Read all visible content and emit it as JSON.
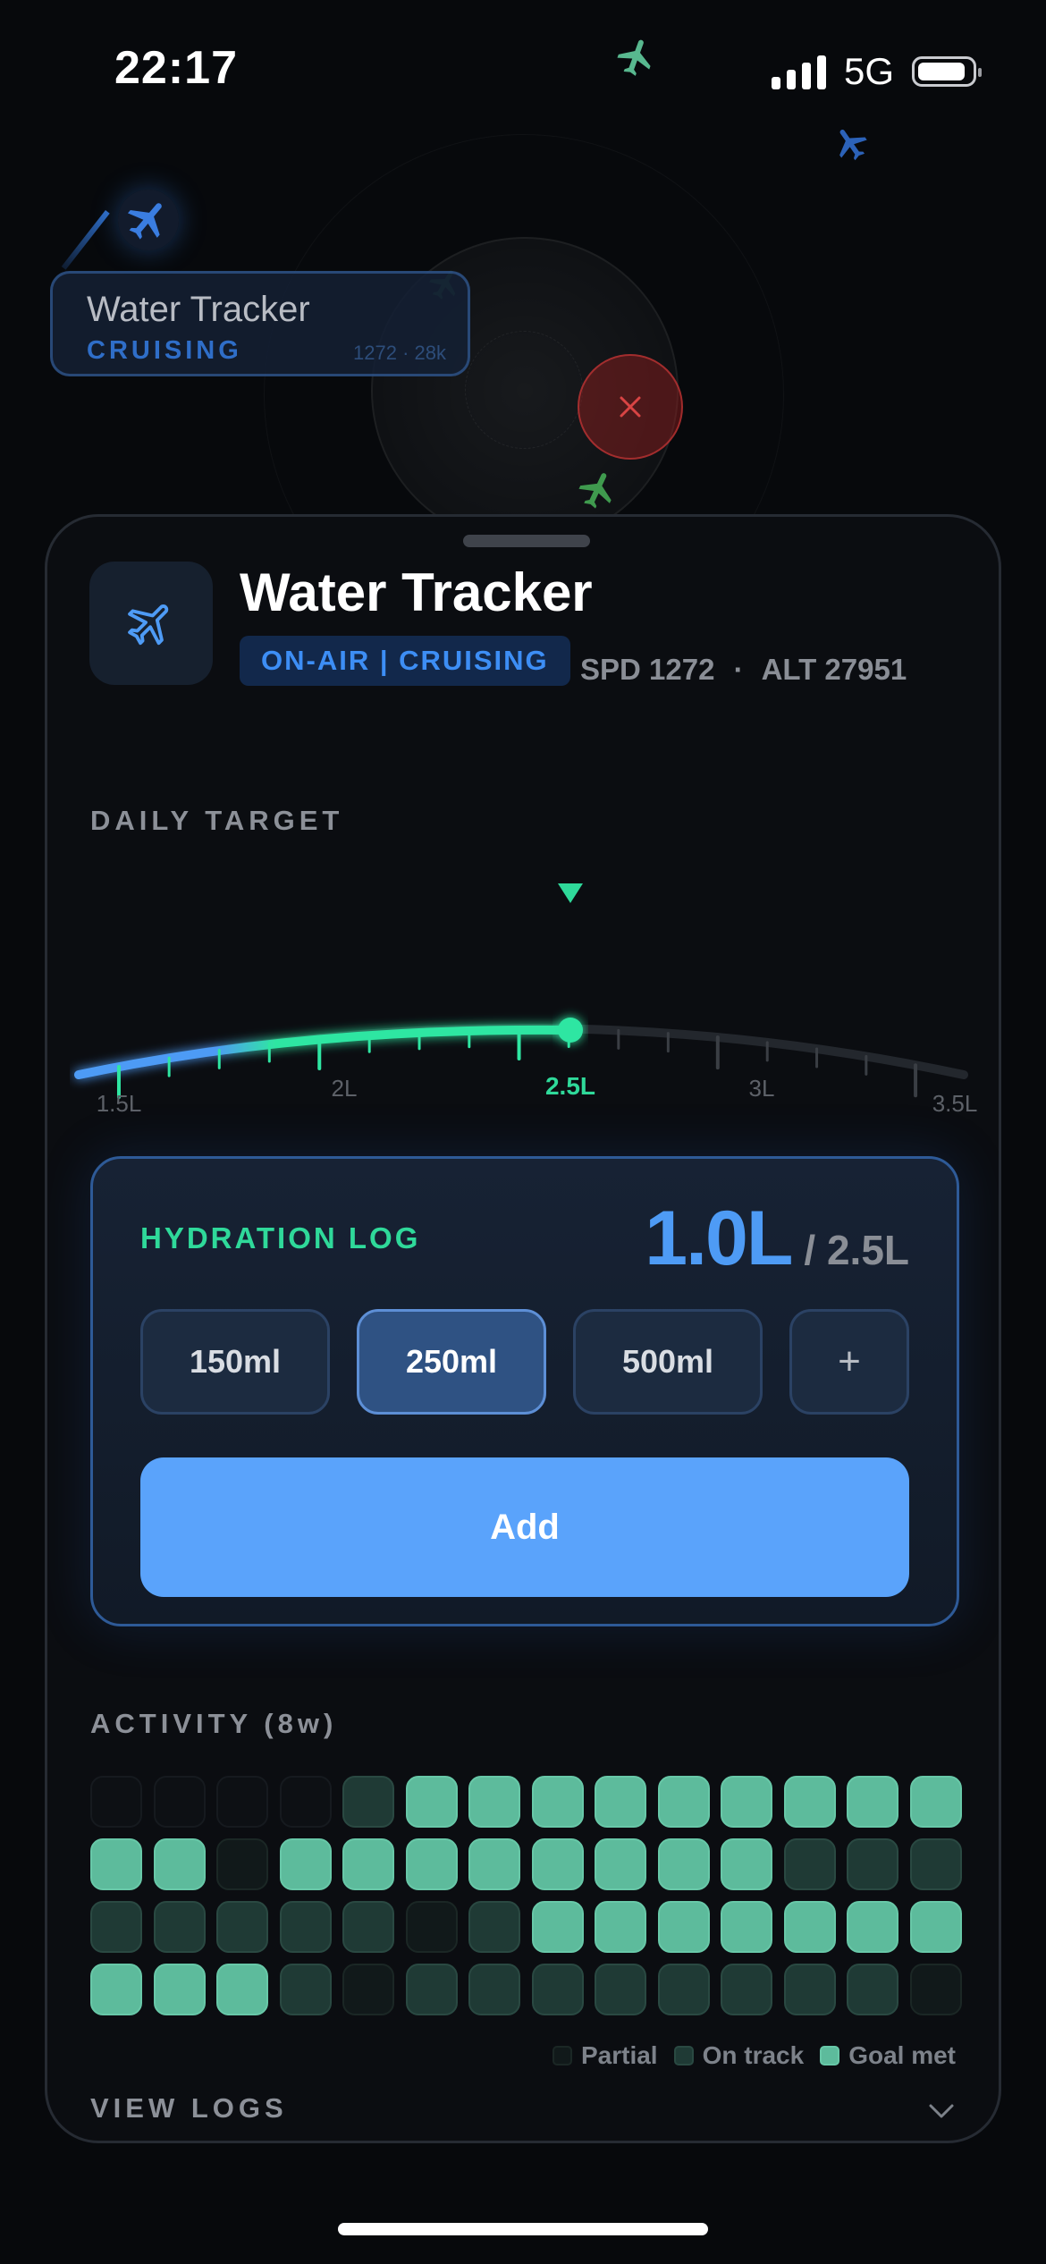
{
  "status_bar": {
    "time": "22:17",
    "network": "5G"
  },
  "map": {
    "flight_tag": {
      "name": "Water Tracker",
      "status": "CRUISING",
      "meta": "1272 · 28k"
    }
  },
  "sheet": {
    "title": "Water Tracker",
    "status_badge": "ON-AIR | CRUISING",
    "speed": "SPD 1272",
    "separator": "·",
    "altitude": "ALT 27951"
  },
  "daily_target": {
    "label": "DAILY TARGET",
    "ticks": [
      "1.5L",
      "2L",
      "2.5L",
      "3L",
      "3.5L"
    ],
    "selected": "2.5L"
  },
  "hydration_log": {
    "title": "HYDRATION LOG",
    "current": "1.0L",
    "goal": "/ 2.5L",
    "amounts": [
      "150ml",
      "250ml",
      "500ml"
    ],
    "selected_amount": "250ml",
    "more_label": "+",
    "add_label": "Add"
  },
  "activity": {
    "label": "ACTIVITY (8w)",
    "levels": [
      [
        0,
        0,
        0,
        0,
        2,
        3,
        3,
        3,
        3,
        3,
        3,
        3,
        3,
        3
      ],
      [
        3,
        3,
        1,
        3,
        3,
        3,
        3,
        3,
        3,
        3,
        3,
        2,
        2,
        2
      ],
      [
        2,
        2,
        2,
        2,
        2,
        1,
        2,
        3,
        3,
        3,
        3,
        3,
        3,
        3
      ],
      [
        3,
        3,
        3,
        2,
        1,
        2,
        2,
        2,
        2,
        2,
        2,
        2,
        2,
        1
      ]
    ],
    "legend": [
      "Partial",
      "On track",
      "Goal met"
    ]
  },
  "view_logs_label": "VIEW LOGS",
  "colors": {
    "accent_blue": "#4e9bf5",
    "accent_green": "#2fd99a",
    "danger_red": "#d94444"
  }
}
